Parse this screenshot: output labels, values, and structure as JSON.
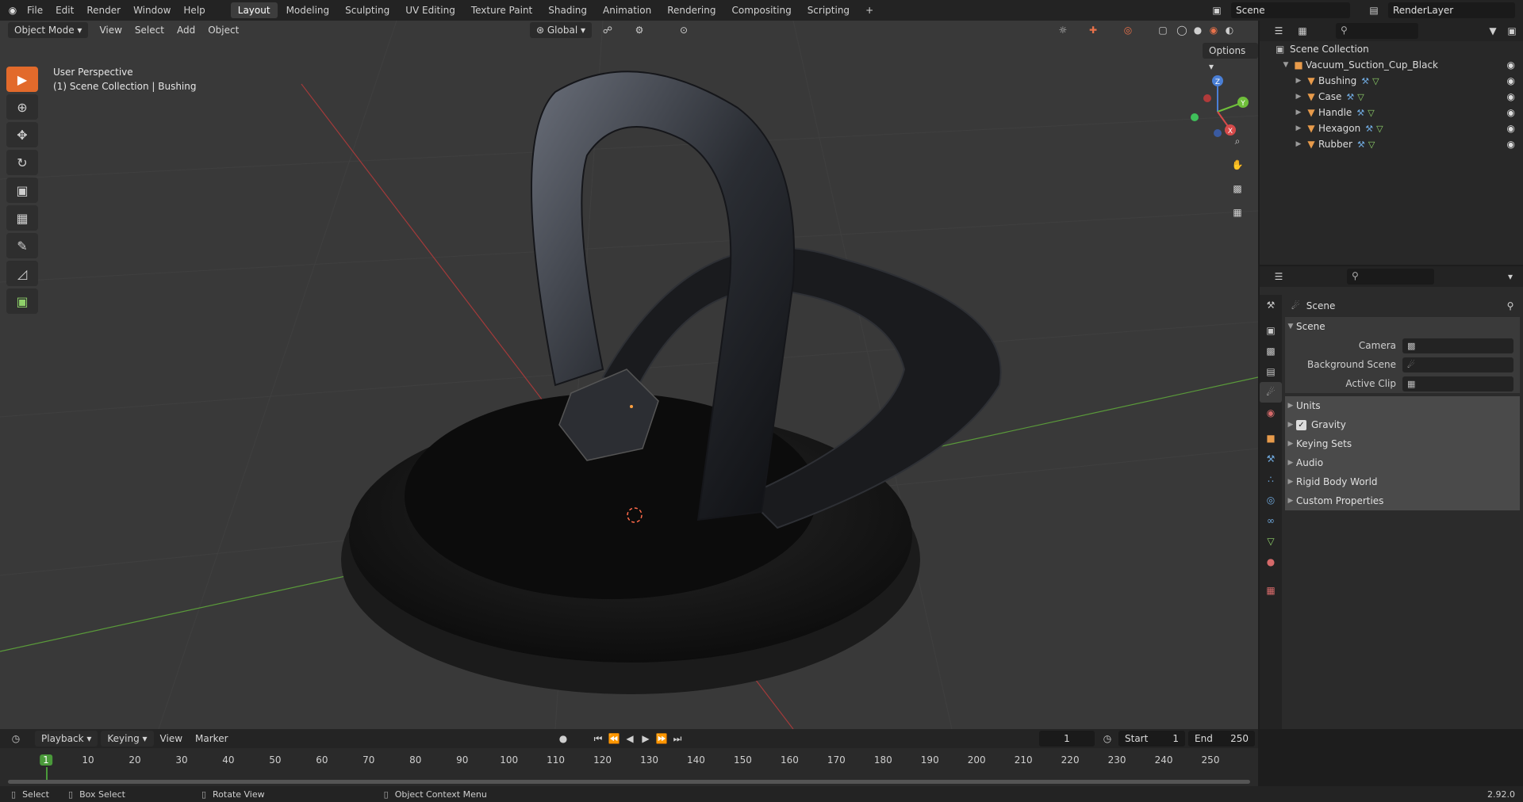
{
  "topbar": {
    "menus": [
      "File",
      "Edit",
      "Render",
      "Window",
      "Help"
    ],
    "workspaces": [
      "Layout",
      "Modeling",
      "Sculpting",
      "UV Editing",
      "Texture Paint",
      "Shading",
      "Animation",
      "Rendering",
      "Compositing",
      "Scripting"
    ],
    "active_workspace": "Layout",
    "add_tab": "+",
    "scene_name": "Scene",
    "view_layer": "RenderLayer"
  },
  "viewport": {
    "mode": "Object Mode",
    "menus": [
      "View",
      "Select",
      "Add",
      "Object"
    ],
    "transform_orientation": "Global",
    "options_label": "Options",
    "perspective_label": "User Perspective",
    "collection_label": "(1) Scene Collection | Bushing",
    "gizmo": {
      "z": "Z",
      "y": "Y",
      "x": "X"
    }
  },
  "outliner": {
    "root": "Scene Collection",
    "collection": "Vacuum_Suction_Cup_Black",
    "objects": [
      "Bushing",
      "Case",
      "Handle",
      "Hexagon",
      "Rubber"
    ]
  },
  "properties": {
    "context": "Scene",
    "panel_title": "Scene",
    "fields": [
      {
        "label": "Camera",
        "value": ""
      },
      {
        "label": "Background Scene",
        "value": ""
      },
      {
        "label": "Active Clip",
        "value": ""
      }
    ],
    "subpanels": [
      "Units",
      "Gravity",
      "Keying Sets",
      "Audio",
      "Rigid Body World",
      "Custom Properties"
    ],
    "gravity_checked": true
  },
  "timeline": {
    "menus": [
      "Playback",
      "Keying",
      "View",
      "Marker"
    ],
    "current_frame": "1",
    "start_label": "Start",
    "start_value": "1",
    "end_label": "End",
    "end_value": "250",
    "frame_ticks": [
      "1",
      "10",
      "20",
      "30",
      "40",
      "50",
      "60",
      "70",
      "80",
      "90",
      "100",
      "110",
      "120",
      "130",
      "140",
      "150",
      "160",
      "170",
      "180",
      "190",
      "200",
      "210",
      "220",
      "230",
      "240",
      "250"
    ]
  },
  "statusbar": {
    "select": "Select",
    "box_select": "Box Select",
    "rotate_view": "Rotate View",
    "context_menu": "Object Context Menu",
    "version": "2.92.0"
  }
}
